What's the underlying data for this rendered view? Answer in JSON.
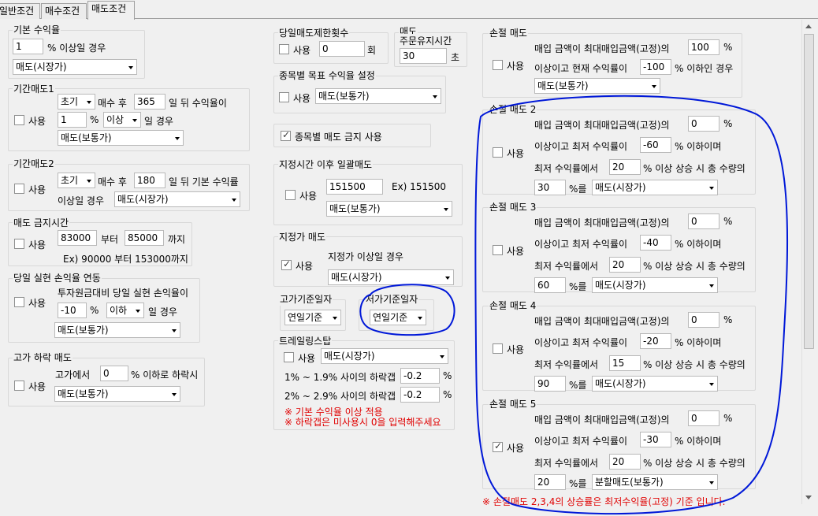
{
  "tabs": [
    "일반조건",
    "매수조건",
    "매도조건"
  ],
  "g1": {
    "title": "기본 수익율",
    "value": "1",
    "suffix": "% 이상일 경우",
    "select": "매도(시장가)"
  },
  "g2": {
    "title": "기간매도1",
    "sel1": "초기",
    "t1": "매수 후",
    "days": "365",
    "t2": "일 뒤 수익율이",
    "use": "사용",
    "val": "1",
    "pct": "%",
    "cond": "이상",
    "t3": "일 경우",
    "sel2": "매도(보통가)"
  },
  "g3": {
    "title": "기간매도2",
    "sel1": "초기",
    "t1": "매수 후",
    "days": "180",
    "t2": "일 뒤 기본 수익률",
    "use": "사용",
    "t3": "이상일 경우",
    "sel2": "매도(시장가)"
  },
  "g4": {
    "title": "매도 금지시간",
    "use": "사용",
    "from": "83000",
    "t1": "부터",
    "to": "85000",
    "t2": "까지",
    "ex": "Ex) 90000 부터 153000까지"
  },
  "g5": {
    "title": "당일 실현 손익율 연동",
    "use": "사용",
    "t1": "투자원금대비 당일 실현 손익율이",
    "val": "-10",
    "pct": "%",
    "cond": "이하",
    "t2": "일 경우",
    "sel": "매도(보통가)"
  },
  "g6": {
    "title": "고가 하락 매도",
    "use": "사용",
    "t1": "고가에서",
    "val": "0",
    "t2": "% 이하로 하락시",
    "sel": "매도(보통가)"
  },
  "m1": {
    "title": "당일매도제한횟수",
    "use": "사용",
    "val": "0",
    "unit": "회"
  },
  "m2": {
    "title1": "매도",
    "title2": "주문유지시간",
    "val": "30",
    "unit": "초"
  },
  "m3": {
    "title": "종목별 목표 수익율 설정",
    "use": "사용",
    "sel": "매도(보통가)"
  },
  "m4": {
    "label": "종목별 매도 금지 사용"
  },
  "m5": {
    "title": "지정시간 이후 일괄매도",
    "use": "사용",
    "val": "151500",
    "ex": "Ex) 151500",
    "sel": "매도(보통가)"
  },
  "m6": {
    "title": "지정가 매도",
    "use": "사용",
    "t1": "지정가 이상일 경우",
    "sel": "매도(시장가)"
  },
  "m7": {
    "title": "고가기준일자",
    "sel": "연일기준"
  },
  "m8": {
    "title": "저가기준일자",
    "sel": "연일기준"
  },
  "m9": {
    "title": "트레일링스탑",
    "use": "사용",
    "sel": "매도(시장가)",
    "r1": "1% ~ 1.9% 사이의 하락갭",
    "v1": "-0.2",
    "r2": "2% ~ 2.9% 사이의 하락갭",
    "v2": "-0.2",
    "pct": "%",
    "n1": "※ 기본 수익율 이상 적용",
    "n2": "※ 하락갭은 미사용시 0을 입력해주세요"
  },
  "s1": {
    "title": "손절 매도",
    "use": "사용",
    "t1": "매입 금액이 최대매입금액(고정)의",
    "v1": "100",
    "pct": "%",
    "t2": "이상이고 현재 수익률이",
    "v2": "-100",
    "t3": "% 이하인 경우",
    "sel": "매도(보통가)"
  },
  "stop_common": {
    "use": "사용",
    "t1": "매입 금액이 최대매입금액(고정)의",
    "pct": "%",
    "t2": "이상이고 최저 수익률이",
    "t3": "% 이하이며",
    "t4": "최저 수익률에서",
    "t5": "% 이상 상승 시 총 수량의",
    "t6": "%를"
  },
  "stops": [
    {
      "title": "손절 매도 2",
      "v1": "0",
      "v2": "-60",
      "v3": "20",
      "v4": "30",
      "sel": "매도(시장가)",
      "checked": false
    },
    {
      "title": "손절 매도 3",
      "v1": "0",
      "v2": "-40",
      "v3": "20",
      "v4": "60",
      "sel": "매도(시장가)",
      "checked": false
    },
    {
      "title": "손절 매도 4",
      "v1": "0",
      "v2": "-20",
      "v3": "15",
      "v4": "90",
      "sel": "매도(시장가)",
      "checked": false
    },
    {
      "title": "손절 매도 5",
      "v1": "0",
      "v2": "-30",
      "v3": "20",
      "v4": "20",
      "sel": "분할매도(보통가)",
      "checked": true
    }
  ],
  "footnote": "※ 손절매도 2,3,4의 상승률은 최저수익율(고정) 기준 입니다.",
  "colors": {
    "annotation": "#0018d8",
    "warning": "#e00000"
  }
}
